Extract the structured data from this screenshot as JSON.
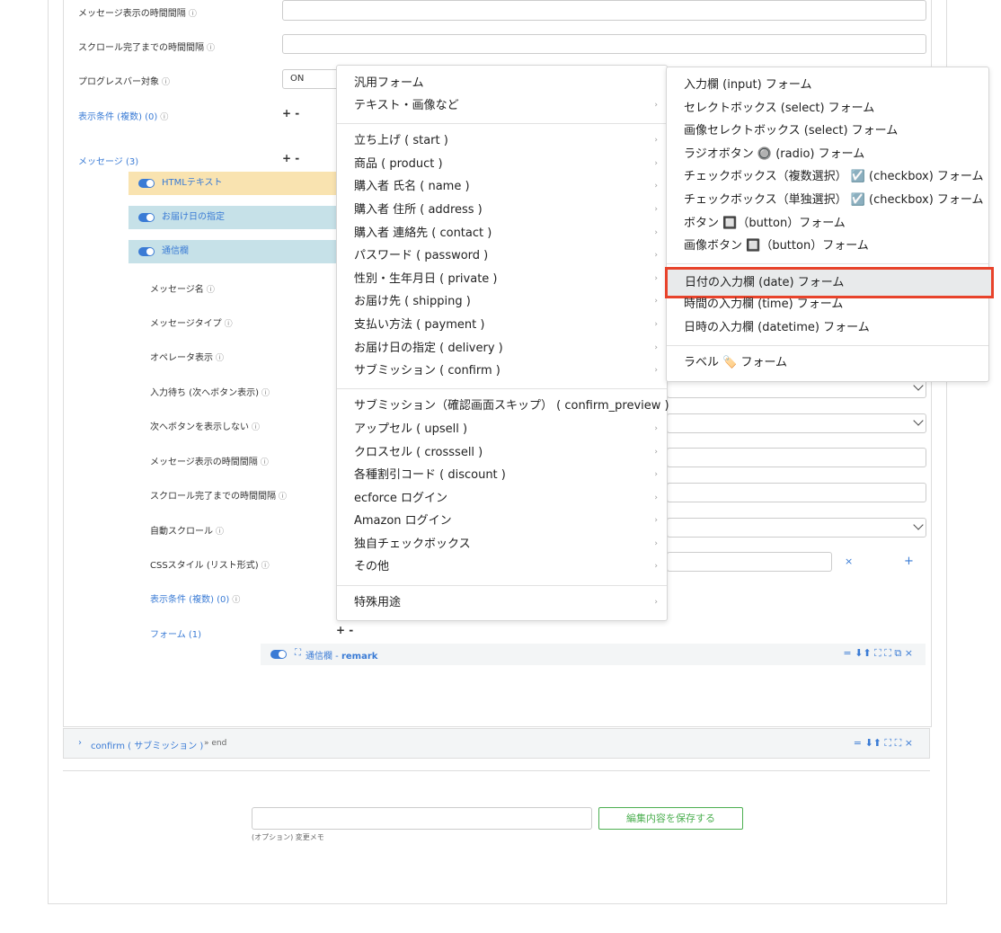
{
  "top_labels": {
    "msg_interval": "メッセージ表示の時間間隔",
    "scroll_interval": "スクロール完了までの時間間隔",
    "progress_target": "プログレスバー対象",
    "progress_value": "ON",
    "display_cond": "表示条件 (複数) (0)",
    "messages": "メッセージ (3)",
    "plus_minus": "+ -"
  },
  "messages": [
    {
      "label": "HTMLテキスト",
      "color": "#f9e3b0"
    },
    {
      "label": "お届け日の指定",
      "color": "#c6e1e8"
    },
    {
      "label": "通信欄",
      "color": "#c6e1e8"
    }
  ],
  "detail_labels": [
    "メッセージ名",
    "メッセージタイプ",
    "オペレータ表示",
    "入力待ち (次へボタン表示)",
    "次へボタンを表示しない",
    "メッセージ表示の時間間隔",
    "スクロール完了までの時間間隔",
    "自動スクロール",
    "CSSスタイル (リスト形式)"
  ],
  "detail_cond": "表示条件 (複数) (0)",
  "detail_form": "フォーム (1)",
  "css_row_controls": {
    "remove": "×",
    "add": "+"
  },
  "form_item": {
    "label": "通信欄",
    "sep": " - ",
    "key": "remark",
    "tools": "= ⬇⬆ ⛶ ⛶ ⧉ ×"
  },
  "confirm_bar": {
    "label": "confirm ( サブミッション )",
    "suffix": "» end",
    "tools": "= ⬇⬆ ⛶ ⛶ ×"
  },
  "save": {
    "button": "編集内容を保存する",
    "memo_label": "(オプション) 変更メモ"
  },
  "menu_main": {
    "group1": [
      "汎用フォーム",
      "テキスト・画像など"
    ],
    "group2": [
      "立ち上げ ( start )",
      "商品 ( product )",
      "購入者 氏名 ( name )",
      "購入者 住所 ( address )",
      "購入者 連絡先 ( contact )",
      "パスワード ( password )",
      "性別・生年月日 ( private )",
      "お届け先 ( shipping )",
      "支払い方法 ( payment )",
      "お届け日の指定 ( delivery )",
      "サブミッション ( confirm )"
    ],
    "group3": [
      "サブミッション（確認画面スキップ） ( confirm_preview )",
      "アップセル ( upsell )",
      "クロスセル ( crosssell )",
      "各種割引コード ( discount )",
      "ecforce ログイン",
      "Amazon ログイン",
      "独自チェックボックス",
      "その他"
    ],
    "group4": [
      "特殊用途"
    ],
    "arrow": "›"
  },
  "menu_sub": {
    "group1": [
      "入力欄 (input) フォーム",
      "セレクトボックス (select) フォーム",
      "画像セレクトボックス (select) フォーム",
      "ラジオボタン 🔘 (radio) フォーム",
      "チェックボックス（複数選択） ☑️ (checkbox) フォーム",
      "チェックボックス（単独選択） ☑️ (checkbox) フォーム",
      "ボタン 🔲（button）フォーム",
      "画像ボタン 🔲（button）フォーム"
    ],
    "group2": [
      "日付の入力欄 (date) フォーム",
      "時間の入力欄 (time) フォーム",
      "日時の入力欄 (datetime) フォーム"
    ],
    "group3": [
      "ラベル 🏷️ フォーム"
    ],
    "highlighted": "日付の入力欄 (date) フォーム"
  }
}
